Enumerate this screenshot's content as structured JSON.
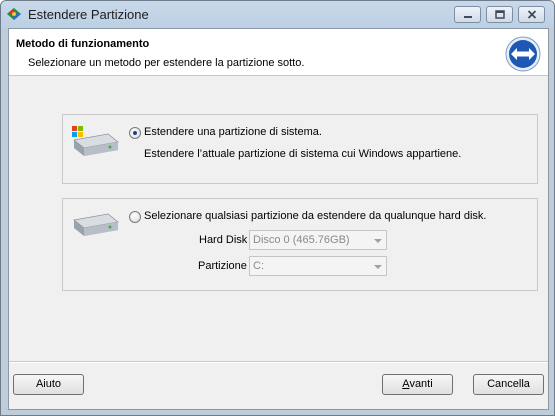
{
  "window": {
    "title": "Estendere Partizione"
  },
  "header": {
    "title": "Metodo di funzionamento",
    "subtitle": "Selezionare un metodo per estendere la partizione sotto."
  },
  "options": [
    {
      "label": "Estendere una partizione di sistema.",
      "description": "Estendere l’attuale partizione di sistema cui Windows appartiene.",
      "selected": true
    },
    {
      "label": "Selezionare qualsiasi partizione da estendere da qualunque hard disk.",
      "selected": false,
      "fields": {
        "hard_disk_label": "Hard Disk",
        "hard_disk_value": "Disco 0 (465.76GB)",
        "partition_label": "Partizione",
        "partition_value": "C:"
      }
    }
  ],
  "buttons": {
    "help": "Aiuto",
    "next_underlined": "A",
    "next_rest": "vanti",
    "cancel": "Cancella"
  }
}
